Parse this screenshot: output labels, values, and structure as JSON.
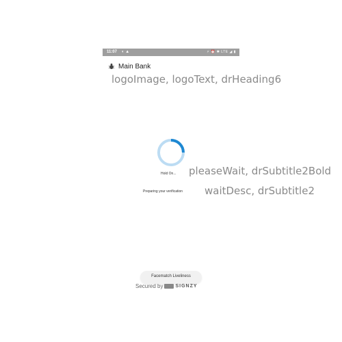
{
  "status_bar": {
    "time": "11:07",
    "left_icons": [
      "sync-icon",
      "warning-icon"
    ],
    "right_icons_text": "⚡ ⏰ ✱ LTE ◢ ▮"
  },
  "app_bar": {
    "logo_icon": "bug-icon",
    "title": "Main Bank"
  },
  "annotations": {
    "logo": "logoImage, logoText, drHeading6",
    "please_wait": "pleaseWait, drSubtitle2Bold",
    "wait_desc": "waitDesc, drSubtitle2"
  },
  "loader": {
    "progress": 0.25,
    "track_color": "#bcdcf3",
    "arc_color": "#1e88d2"
  },
  "please_wait_text": "Hold On...",
  "wait_desc_text": "Preparing your verification",
  "footer": {
    "pill_label": "Facematch Liveliness",
    "secured_by": "Secured by",
    "brand": "SIGNZY"
  }
}
